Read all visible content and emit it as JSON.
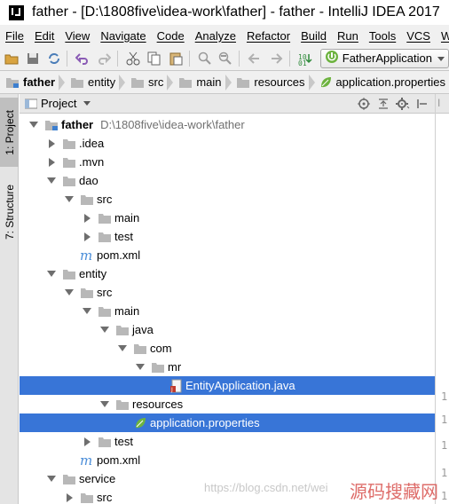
{
  "window": {
    "title": "father - [D:\\1808five\\idea-work\\father] - father - IntelliJ IDEA 2017"
  },
  "menu": [
    "File",
    "Edit",
    "View",
    "Navigate",
    "Code",
    "Analyze",
    "Refactor",
    "Build",
    "Run",
    "Tools",
    "VCS",
    "W"
  ],
  "toolbar": {
    "run_config": "FatherApplication",
    "icons": [
      "open-icon",
      "save-icon",
      "sync-icon",
      "undo-icon",
      "redo-icon",
      "cut-icon",
      "copy-icon",
      "paste-icon",
      "find-icon",
      "replace-icon",
      "back-icon",
      "forward-icon",
      "build-icon",
      "run-config-dropdown"
    ]
  },
  "breadcrumbs": [
    "father",
    "entity",
    "src",
    "main",
    "resources",
    "application.properties"
  ],
  "side_tabs": [
    "1: Project",
    "7: Structure"
  ],
  "panel": {
    "title": "Project"
  },
  "tree": [
    {
      "label": "father",
      "path": "D:\\1808five\\idea-work\\father",
      "state": "open",
      "icon": "module-folder",
      "bold": true
    },
    {
      "label": ".idea",
      "state": "closed",
      "icon": "folder"
    },
    {
      "label": ".mvn",
      "state": "closed",
      "icon": "folder"
    },
    {
      "label": "dao",
      "state": "open",
      "icon": "folder"
    },
    {
      "label": "src",
      "state": "open",
      "icon": "folder"
    },
    {
      "label": "main",
      "state": "closed",
      "icon": "folder"
    },
    {
      "label": "test",
      "state": "closed",
      "icon": "folder"
    },
    {
      "label": "pom.xml",
      "state": "leaf",
      "icon": "maven"
    },
    {
      "label": "entity",
      "state": "open",
      "icon": "folder"
    },
    {
      "label": "src",
      "state": "open",
      "icon": "folder"
    },
    {
      "label": "main",
      "state": "open",
      "icon": "folder"
    },
    {
      "label": "java",
      "state": "open",
      "icon": "folder"
    },
    {
      "label": "com",
      "state": "open",
      "icon": "folder"
    },
    {
      "label": "mr",
      "state": "open",
      "icon": "folder"
    },
    {
      "label": "EntityApplication.java",
      "state": "leaf",
      "icon": "java-file",
      "selected": true
    },
    {
      "label": "resources",
      "state": "open",
      "icon": "folder"
    },
    {
      "label": "application.properties",
      "state": "leaf",
      "icon": "spring-leaf",
      "selected": true
    },
    {
      "label": "test",
      "state": "closed",
      "icon": "folder"
    },
    {
      "label": "pom.xml",
      "state": "leaf",
      "icon": "maven"
    },
    {
      "label": "service",
      "state": "open",
      "icon": "folder"
    },
    {
      "label": "src",
      "state": "closed",
      "icon": "folder"
    }
  ],
  "gutter": [
    "1",
    "1",
    "1",
    "1",
    "1"
  ],
  "watermark": {
    "url": "https://blog.csdn.net/wei",
    "cn": "源码搜藏网"
  },
  "colors": {
    "selection": "#3875d7",
    "folder": "#b8b8b8",
    "spring": "#6db33f",
    "maven": "#4a8dd8"
  }
}
